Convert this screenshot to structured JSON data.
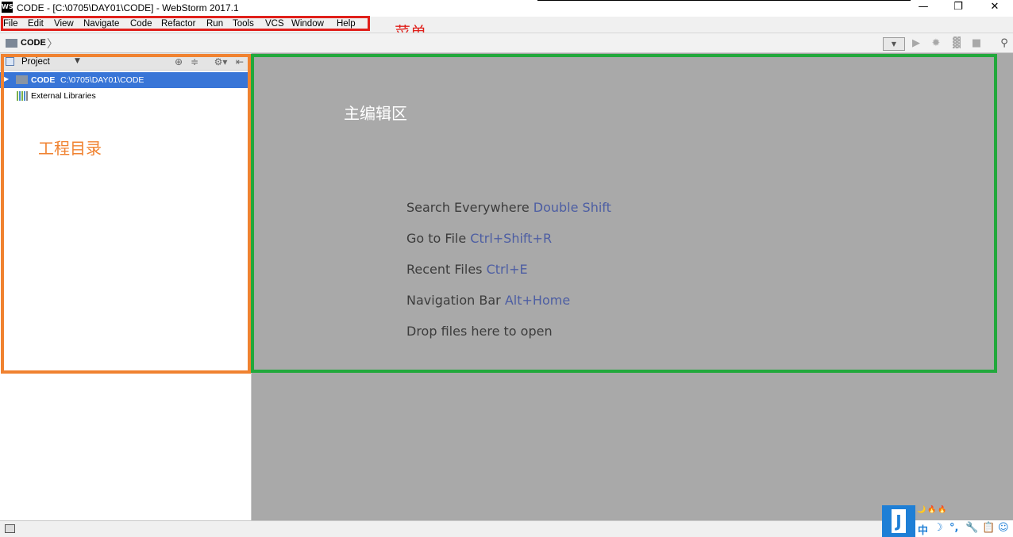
{
  "app": {
    "logo_text": "WS",
    "window_title": "CODE - [C:\\0705\\DAY01\\CODE] - WebStorm 2017.1",
    "controls": {
      "minimize": "—",
      "restore": "❐",
      "close": "✕"
    }
  },
  "menu": {
    "items": [
      "File",
      "Edit",
      "View",
      "Navigate",
      "Code",
      "Refactor",
      "Run",
      "Tools",
      "VCS",
      "Window",
      "Help"
    ]
  },
  "navbar": {
    "breadcrumb": "CODE",
    "chevron": "〉",
    "toolbar": {
      "dropdown": "▼",
      "run": "▶",
      "debug": "✹",
      "coverage": "▓",
      "stop": "■",
      "search": "⚲"
    }
  },
  "project_panel": {
    "title": "Project",
    "dropdown_glyph": "▼",
    "header_buttons": {
      "locate": "⊕",
      "collapse": "≑",
      "settings": "⚙▾",
      "hide": "⇤"
    },
    "tree": [
      {
        "arrow": "▶",
        "name": "CODE",
        "path": "C:\\0705\\DAY01\\CODE",
        "selected": true
      },
      {
        "name": "External Libraries"
      }
    ]
  },
  "annotations": {
    "menu": "菜单",
    "project": "工程目录",
    "editor": "主编辑区",
    "menu_color": "#e0201b",
    "project_color": "#f08230",
    "editor_color": "#22a83c"
  },
  "editor": {
    "hints": [
      {
        "label": "Search Everywhere",
        "shortcut": "Double Shift"
      },
      {
        "label": "Go to File",
        "shortcut": "Ctrl+Shift+R"
      },
      {
        "label": "Recent Files",
        "shortcut": "Ctrl+E"
      },
      {
        "label": "Navigation Bar",
        "shortcut": "Alt+Home"
      },
      {
        "label": "Drop files here to open",
        "shortcut": ""
      }
    ]
  },
  "statusbar": {
    "toggle_icon": "tool-windows-icon"
  },
  "ime": {
    "logo": "J",
    "deco": "🌙🔥🔥",
    "items": [
      "中",
      "☽",
      "°,",
      "🔧",
      "📋",
      "☺"
    ]
  }
}
